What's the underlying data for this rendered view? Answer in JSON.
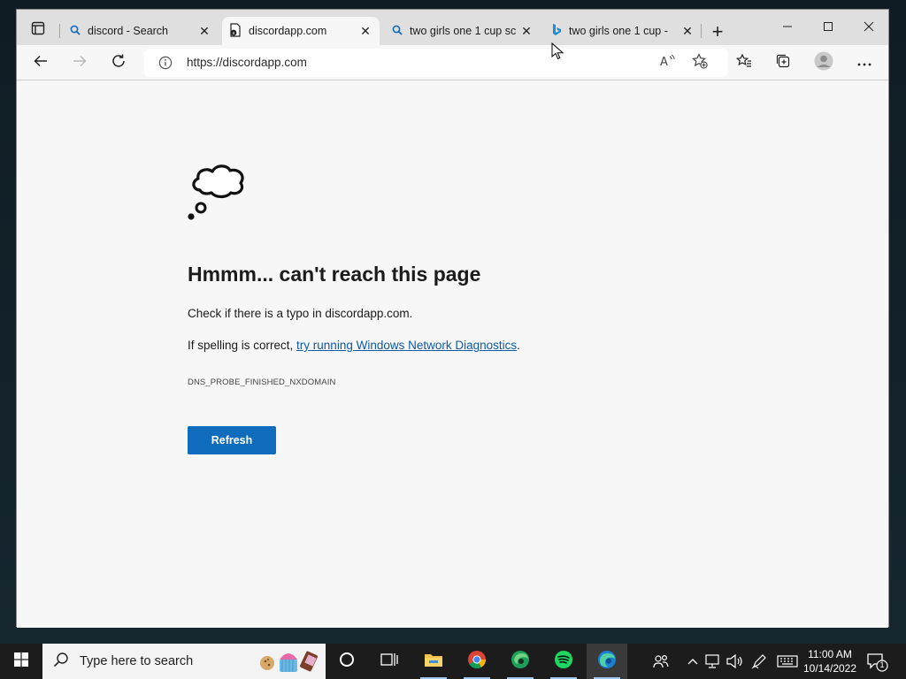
{
  "browser": {
    "tabs": [
      {
        "title": "discord - Search",
        "icon": "search-icon"
      },
      {
        "title": "discordapp.com",
        "icon": "page-error-icon"
      },
      {
        "title": "two girls one 1 cup sc",
        "icon": "search-icon"
      },
      {
        "title": "two girls one 1 cup -",
        "icon": "bing-icon"
      }
    ],
    "address": {
      "url": "https://discordapp.com"
    }
  },
  "error_page": {
    "title": "Hmmm... can't reach this page",
    "line1": "Check if there is a typo in discordapp.com.",
    "line2_prefix": "If spelling is correct, ",
    "line2_link": "try running Windows Network Diagnostics",
    "line2_suffix": ".",
    "code": "DNS_PROBE_FINISHED_NXDOMAIN",
    "refresh_label": "Refresh"
  },
  "taskbar": {
    "search_placeholder": "Type here to search",
    "clock": {
      "time": "11:00 AM",
      "date": "10/14/2022"
    },
    "notification_count": "1",
    "apps": [
      "task-view",
      "file-explorer",
      "chrome",
      "edge-dev",
      "spotify",
      "edge"
    ]
  },
  "colors": {
    "accent": "#0f6cbd",
    "link": "#0f5aa7",
    "tabstrip": "#dfdfdf",
    "page_bg": "#f7f7f7",
    "taskbar": "#1c1c1c"
  }
}
